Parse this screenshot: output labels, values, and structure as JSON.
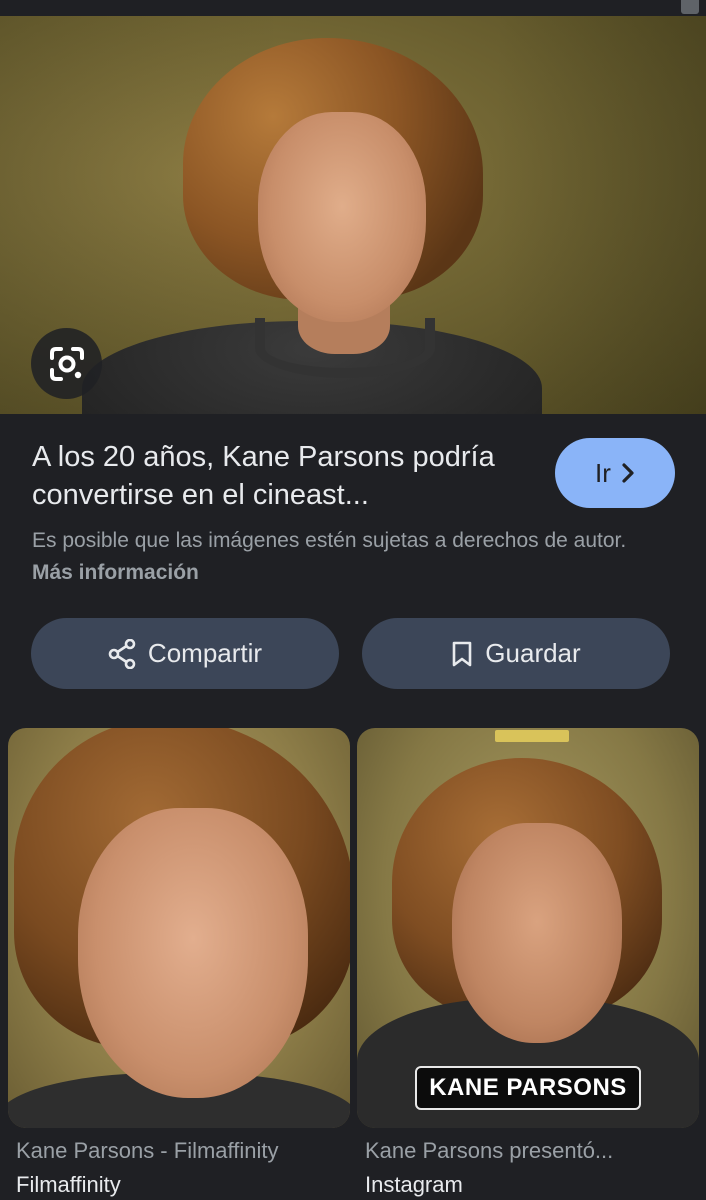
{
  "result": {
    "title": "A los 20 años, Kane Parsons podría convertirse en el cineast...",
    "go_label": "Ir",
    "notice_text": "Es posible que las imágenes estén sujetas a derechos de autor.",
    "notice_link": "Más información",
    "icons": {
      "lens": "google-lens-icon",
      "go": "chevron-right-icon",
      "share": "share-icon",
      "save": "bookmark-icon"
    }
  },
  "actions": {
    "share_label": "Compartir",
    "save_label": "Guardar"
  },
  "related": [
    {
      "title": "Kane Parsons - Filmaffinity",
      "source": "Filmaffinity"
    },
    {
      "title": "Kane Parsons presentó...",
      "source": "Instagram",
      "overlay_text": "KANE PARSONS"
    }
  ],
  "colors": {
    "background": "#1f2024",
    "accent": "#8ab4f8",
    "button": "#3c4658"
  }
}
